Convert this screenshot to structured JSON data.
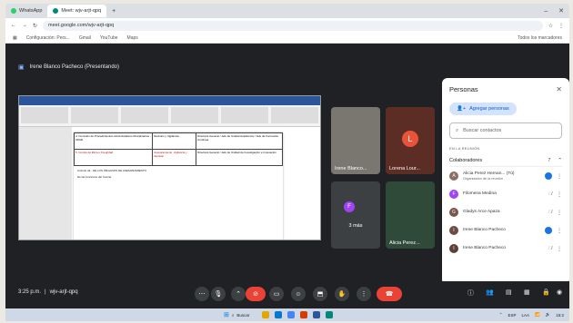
{
  "browser": {
    "tabs": [
      {
        "label": "WhatsApp",
        "color": "#25d366"
      },
      {
        "label": "Meet: wjv-arjt-qpq",
        "color": "#00897b"
      }
    ],
    "new_tab": "+",
    "win_min": "–",
    "win_close": "✕",
    "url": "meet.google.com/wjv-arjt-qpq",
    "bookmarks": [
      "Configuración: Pers...",
      "Gmail",
      "YouTube",
      "Maps"
    ],
    "bookmarks_right": "Todos los marcadores"
  },
  "meet": {
    "presenting_label": "Irene Blanco Pacheco (Presentando)",
    "time": "3:25 p.m.",
    "separator": "|",
    "code": "wjv-arjt-qpq"
  },
  "shared_doc": {
    "rows": [
      {
        "c1": "4. Comisión de Procedimientos Administrativos Disciplinarios - CPAD",
        "c2": "Revisión y Vigilancia",
        "c3": "Directora General / Jefe de Unidad Académica / Jefe de Formación Continua"
      },
      {
        "c1": "5. Comité de Ética e Integridad",
        "c2": "Asesoramiento, vigilancia y decisión",
        "c3": "Directora General / Jefe de Unidad de Investigación e Innovación"
      }
    ],
    "footer1": "Artículo 44.- DE LOS ÓRGANOS DE ASESORAMIENTO",
    "footer2": "De las funciones del Comité"
  },
  "tiles": [
    {
      "name": "Irene Blanco...",
      "initial": ""
    },
    {
      "name": "Lorena Lour...",
      "initial": "L"
    },
    {
      "name": "",
      "initial": "F",
      "more": "3 más"
    },
    {
      "name": "Alicia Perez...",
      "initial": ""
    }
  ],
  "people": {
    "title": "Personas",
    "close": "✕",
    "add_label": "Agregar personas",
    "search_placeholder": "Buscar contactos",
    "section": "EN LA REUNIÓN",
    "collab_label": "Colaboradores",
    "collab_count": "7",
    "list": [
      {
        "name": "Alicia Perez Hernan... (Tú)",
        "sub": "Organizador de la reunión",
        "initial": "A",
        "color": "#8d6e63"
      },
      {
        "name": "Filomena Medina",
        "sub": "",
        "initial": "F",
        "color": "#a142f4"
      },
      {
        "name": "Gladys Arce Apaza",
        "sub": "",
        "initial": "G",
        "color": "#795548"
      },
      {
        "name": "Irene Blanco Pacheco",
        "sub": "",
        "initial": "I",
        "color": "#6d4c41"
      },
      {
        "name": "Irene Blanco Pacheco",
        "sub": "",
        "initial": "I",
        "color": "#5d4037"
      }
    ]
  },
  "taskbar": {
    "search": "Buscar",
    "lang": "ESP",
    "region": "LAA",
    "time": "15:2"
  }
}
